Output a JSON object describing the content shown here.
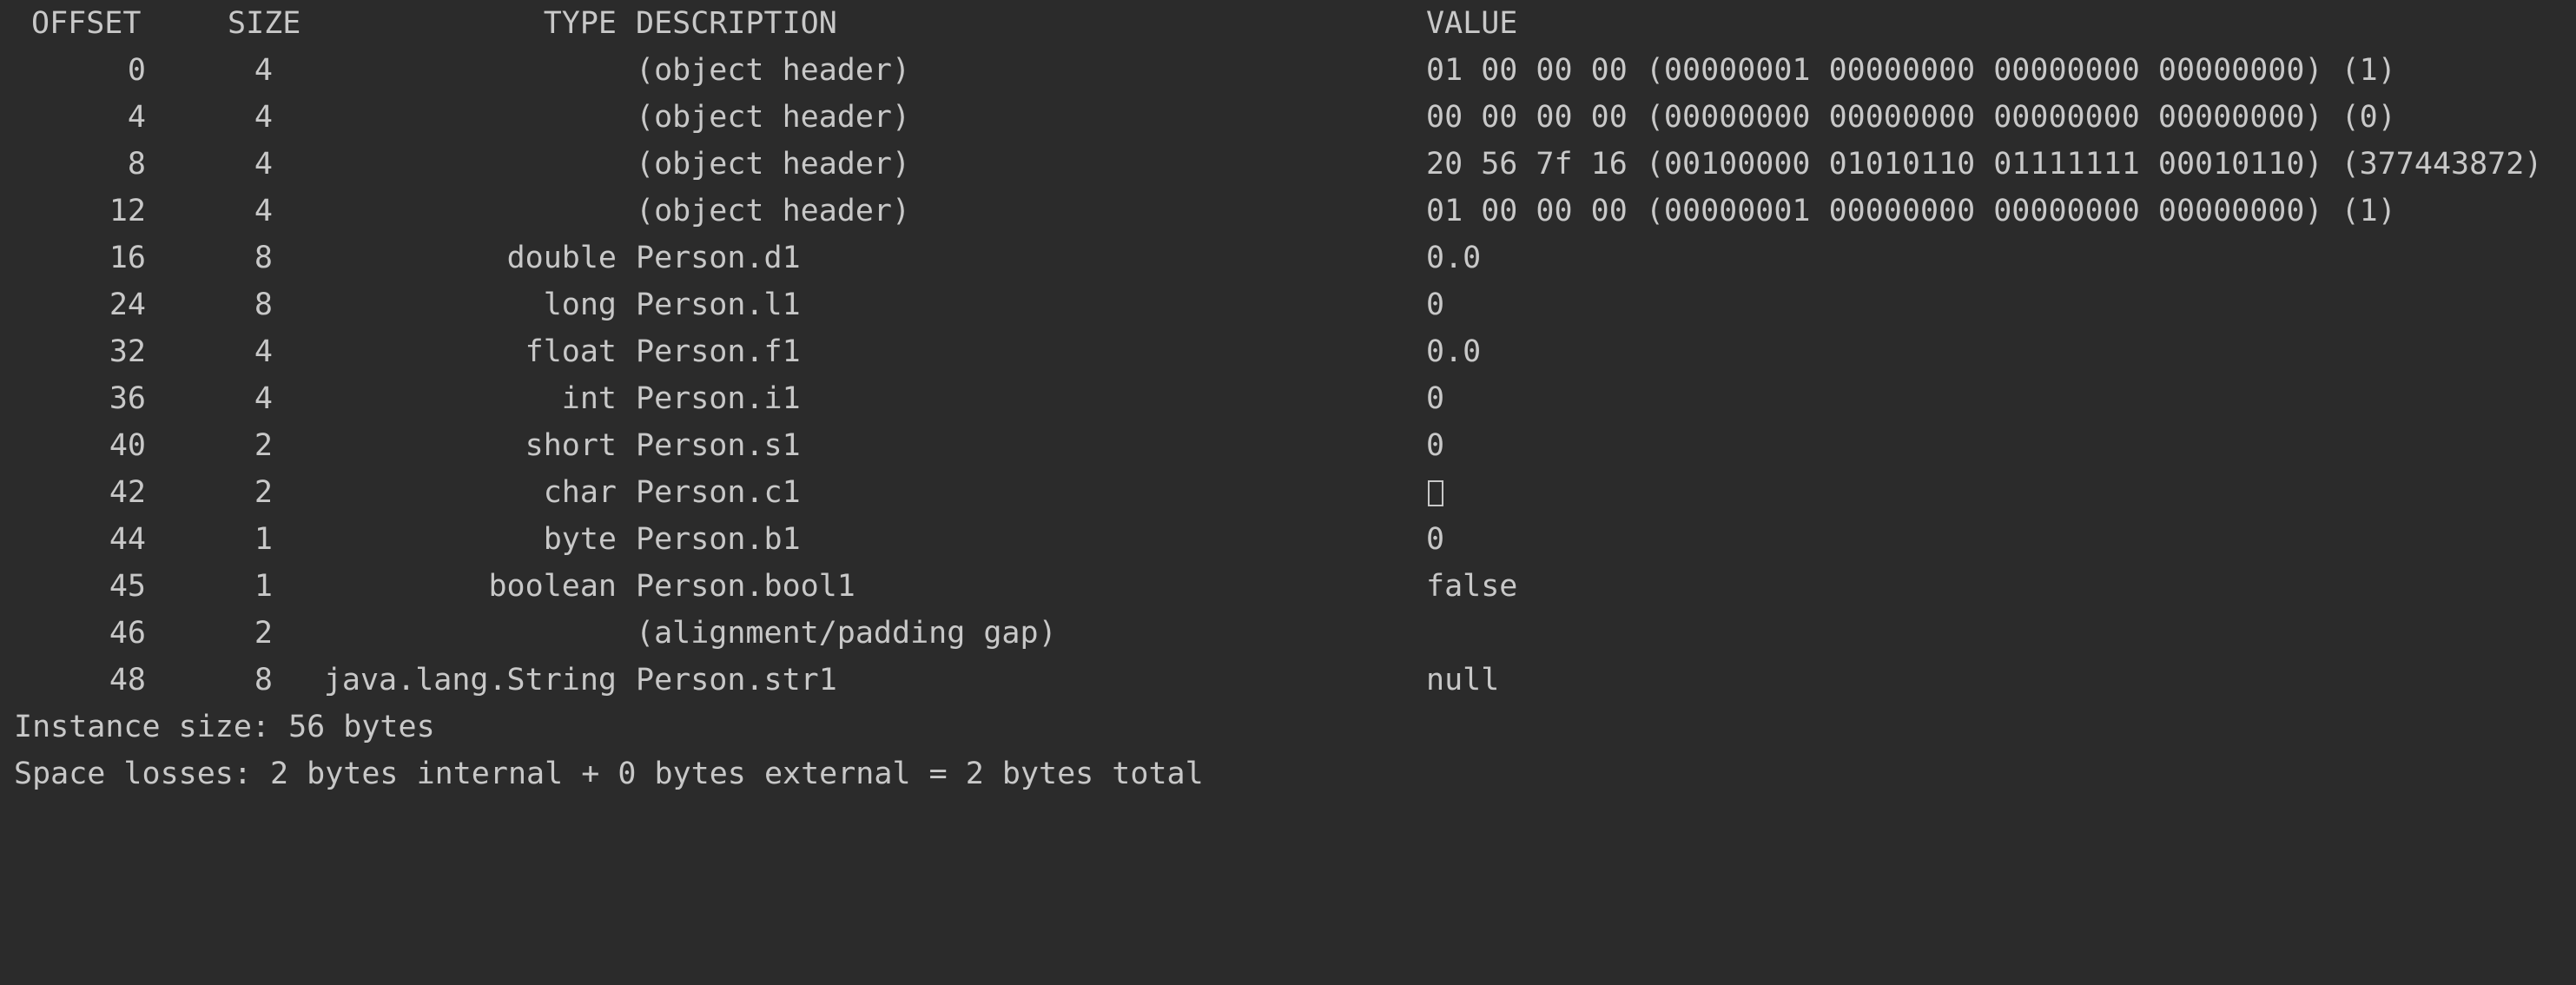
{
  "headers": {
    "offset": "OFFSET",
    "size": "SIZE",
    "type": "TYPE",
    "description": "DESCRIPTION",
    "value": "VALUE"
  },
  "rows": [
    {
      "offset": "0",
      "size": "4",
      "type": "",
      "description": "(object header)",
      "value": "01 00 00 00 (00000001 00000000 00000000 00000000) (1)"
    },
    {
      "offset": "4",
      "size": "4",
      "type": "",
      "description": "(object header)",
      "value": "00 00 00 00 (00000000 00000000 00000000 00000000) (0)"
    },
    {
      "offset": "8",
      "size": "4",
      "type": "",
      "description": "(object header)",
      "value": "20 56 7f 16 (00100000 01010110 01111111 00010110) (377443872)"
    },
    {
      "offset": "12",
      "size": "4",
      "type": "",
      "description": "(object header)",
      "value": "01 00 00 00 (00000001 00000000 00000000 00000000) (1)"
    },
    {
      "offset": "16",
      "size": "8",
      "type": "double",
      "description": "Person.d1",
      "value": "0.0"
    },
    {
      "offset": "24",
      "size": "8",
      "type": "long",
      "description": "Person.l1",
      "value": "0"
    },
    {
      "offset": "32",
      "size": "4",
      "type": "float",
      "description": "Person.f1",
      "value": "0.0"
    },
    {
      "offset": "36",
      "size": "4",
      "type": "int",
      "description": "Person.i1",
      "value": "0"
    },
    {
      "offset": "40",
      "size": "2",
      "type": "short",
      "description": "Person.s1",
      "value": "0"
    },
    {
      "offset": "42",
      "size": "2",
      "type": "char",
      "description": "Person.c1",
      "value": ""
    },
    {
      "offset": "44",
      "size": "1",
      "type": "byte",
      "description": "Person.b1",
      "value": "0"
    },
    {
      "offset": "45",
      "size": "1",
      "type": "boolean",
      "description": "Person.bool1",
      "value": "false"
    },
    {
      "offset": "46",
      "size": "2",
      "type": "",
      "description": "(alignment/padding gap)",
      "value": ""
    },
    {
      "offset": "48",
      "size": "8",
      "type": "java.lang.String",
      "description": "Person.str1",
      "value": "null"
    }
  ],
  "summary": {
    "instance_size": "Instance size: 56 bytes",
    "space_losses": "Space losses: 2 bytes internal + 0 bytes external = 2 bytes total"
  }
}
